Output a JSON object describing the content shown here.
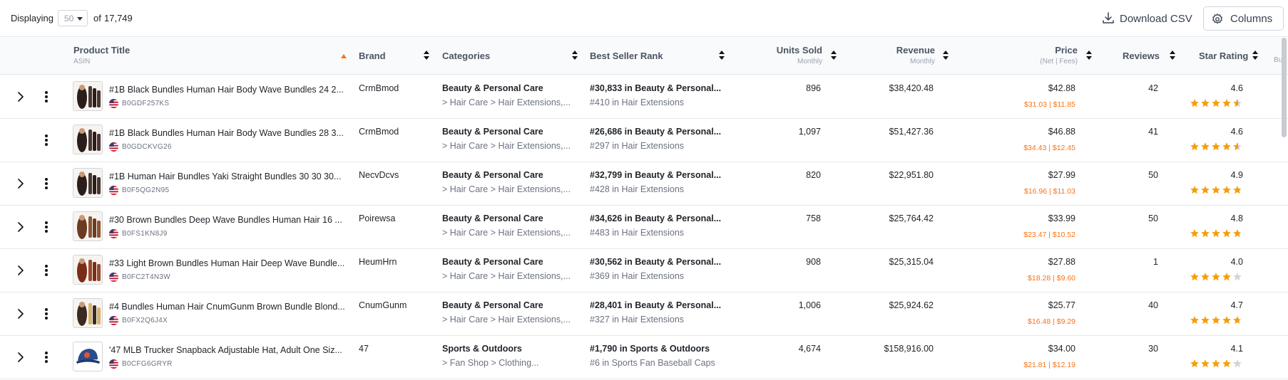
{
  "toolbar": {
    "displaying_label": "Displaying",
    "page_size": "50",
    "of_label": "of",
    "total": "17,749",
    "download_label": "Download CSV",
    "columns_label": "Columns"
  },
  "columns": {
    "product_title": "Product Title",
    "product_sub": "ASIN",
    "brand": "Brand",
    "categories": "Categories",
    "bsr": "Best Seller Rank",
    "units": "Units Sold",
    "units_sub": "Monthly",
    "revenue": "Revenue",
    "revenue_sub": "Monthly",
    "price": "Price",
    "price_sub": "(Net | Fees)",
    "reviews": "Reviews",
    "rating": "Star Rating",
    "clipped": "Bu"
  },
  "colors": {
    "accent": "#f97316",
    "star": "#f59e0b",
    "star_empty": "#d1d5db"
  },
  "rows": [
    {
      "title": "#1B Black Bundles Human Hair Body Wave Bundles 24 2...",
      "asin": "B0GDF257KS",
      "brand": "CrmBmod",
      "cat_main": "Beauty & Personal Care",
      "cat_sub": "> Hair Care > Hair Extensions,...",
      "bsr_main": "#30,833 in Beauty & Personal...",
      "bsr_sub": "#410 in Hair Extensions",
      "units": "896",
      "revenue": "$38,420.48",
      "price": "$42.88",
      "fees": "$31.03 | $11.85",
      "reviews": "42",
      "rating": "4.6",
      "expandable": true,
      "thumb": "hair-dark"
    },
    {
      "title": "#1B Black Bundles Human Hair Body Wave Bundles 28 3...",
      "asin": "B0GDCKVG26",
      "brand": "CrmBmod",
      "cat_main": "Beauty & Personal Care",
      "cat_sub": "> Hair Care > Hair Extensions,...",
      "bsr_main": "#26,686 in Beauty & Personal...",
      "bsr_sub": "#297 in Hair Extensions",
      "units": "1,097",
      "revenue": "$51,427.36",
      "price": "$46.88",
      "fees": "$34.43 | $12.45",
      "reviews": "41",
      "rating": "4.6",
      "expandable": false,
      "thumb": "hair-dark"
    },
    {
      "title": "#1B Human Hair Bundles Yaki Straight Bundles 30 30 30...",
      "asin": "B0F5QG2N95",
      "brand": "NecvDcvs",
      "cat_main": "Beauty & Personal Care",
      "cat_sub": "> Hair Care > Hair Extensions,...",
      "bsr_main": "#32,799 in Beauty & Personal...",
      "bsr_sub": "#428 in Hair Extensions",
      "units": "820",
      "revenue": "$22,951.80",
      "price": "$27.99",
      "fees": "$16.96 | $11.03",
      "reviews": "50",
      "rating": "4.9",
      "expandable": true,
      "thumb": "hair-dark"
    },
    {
      "title": "#30 Brown Bundles Deep Wave Bundles Human Hair 16 ...",
      "asin": "B0FS1KN8J9",
      "brand": "Poirewsa",
      "cat_main": "Beauty & Personal Care",
      "cat_sub": "> Hair Care > Hair Extensions,...",
      "bsr_main": "#34,626 in Beauty & Personal...",
      "bsr_sub": "#483 in Hair Extensions",
      "units": "758",
      "revenue": "$25,764.42",
      "price": "$33.99",
      "fees": "$23.47 | $10.52",
      "reviews": "50",
      "rating": "4.8",
      "expandable": true,
      "thumb": "hair-brown"
    },
    {
      "title": "#33 Light Brown Bundles Human Hair Deep Wave Bundle...",
      "asin": "B0FC2T4N3W",
      "brand": "HeumHrn",
      "cat_main": "Beauty & Personal Care",
      "cat_sub": "> Hair Care > Hair Extensions,...",
      "bsr_main": "#30,562 in Beauty & Personal...",
      "bsr_sub": "#369 in Hair Extensions",
      "units": "908",
      "revenue": "$25,315.04",
      "price": "$27.88",
      "fees": "$18.28 | $9.60",
      "reviews": "1",
      "rating": "4.0",
      "expandable": true,
      "thumb": "hair-auburn"
    },
    {
      "title": "#4 Bundles Human Hair CnumGunm Brown Bundle Blond...",
      "asin": "B0FX2Q6J4X",
      "brand": "CnumGunm",
      "cat_main": "Beauty & Personal Care",
      "cat_sub": "> Hair Care > Hair Extensions,...",
      "bsr_main": "#28,401 in Beauty & Personal...",
      "bsr_sub": "#327 in Hair Extensions",
      "units": "1,006",
      "revenue": "$25,924.62",
      "price": "$25.77",
      "fees": "$16.48 | $9.29",
      "reviews": "40",
      "rating": "4.7",
      "expandable": true,
      "thumb": "hair-blond"
    },
    {
      "title": "'47 MLB Trucker Snapback Adjustable Hat, Adult One Siz...",
      "asin": "B0CFG6GRYR",
      "brand": "47",
      "cat_main": "Sports & Outdoors",
      "cat_sub": "> Fan Shop > Clothing...",
      "bsr_main": "#1,790 in Sports & Outdoors",
      "bsr_sub": "#6 in Sports Fan Baseball Caps",
      "units": "4,674",
      "revenue": "$158,916.00",
      "price": "$34.00",
      "fees": "$21.81 | $12.19",
      "reviews": "30",
      "rating": "4.1",
      "expandable": true,
      "thumb": "hat"
    }
  ]
}
